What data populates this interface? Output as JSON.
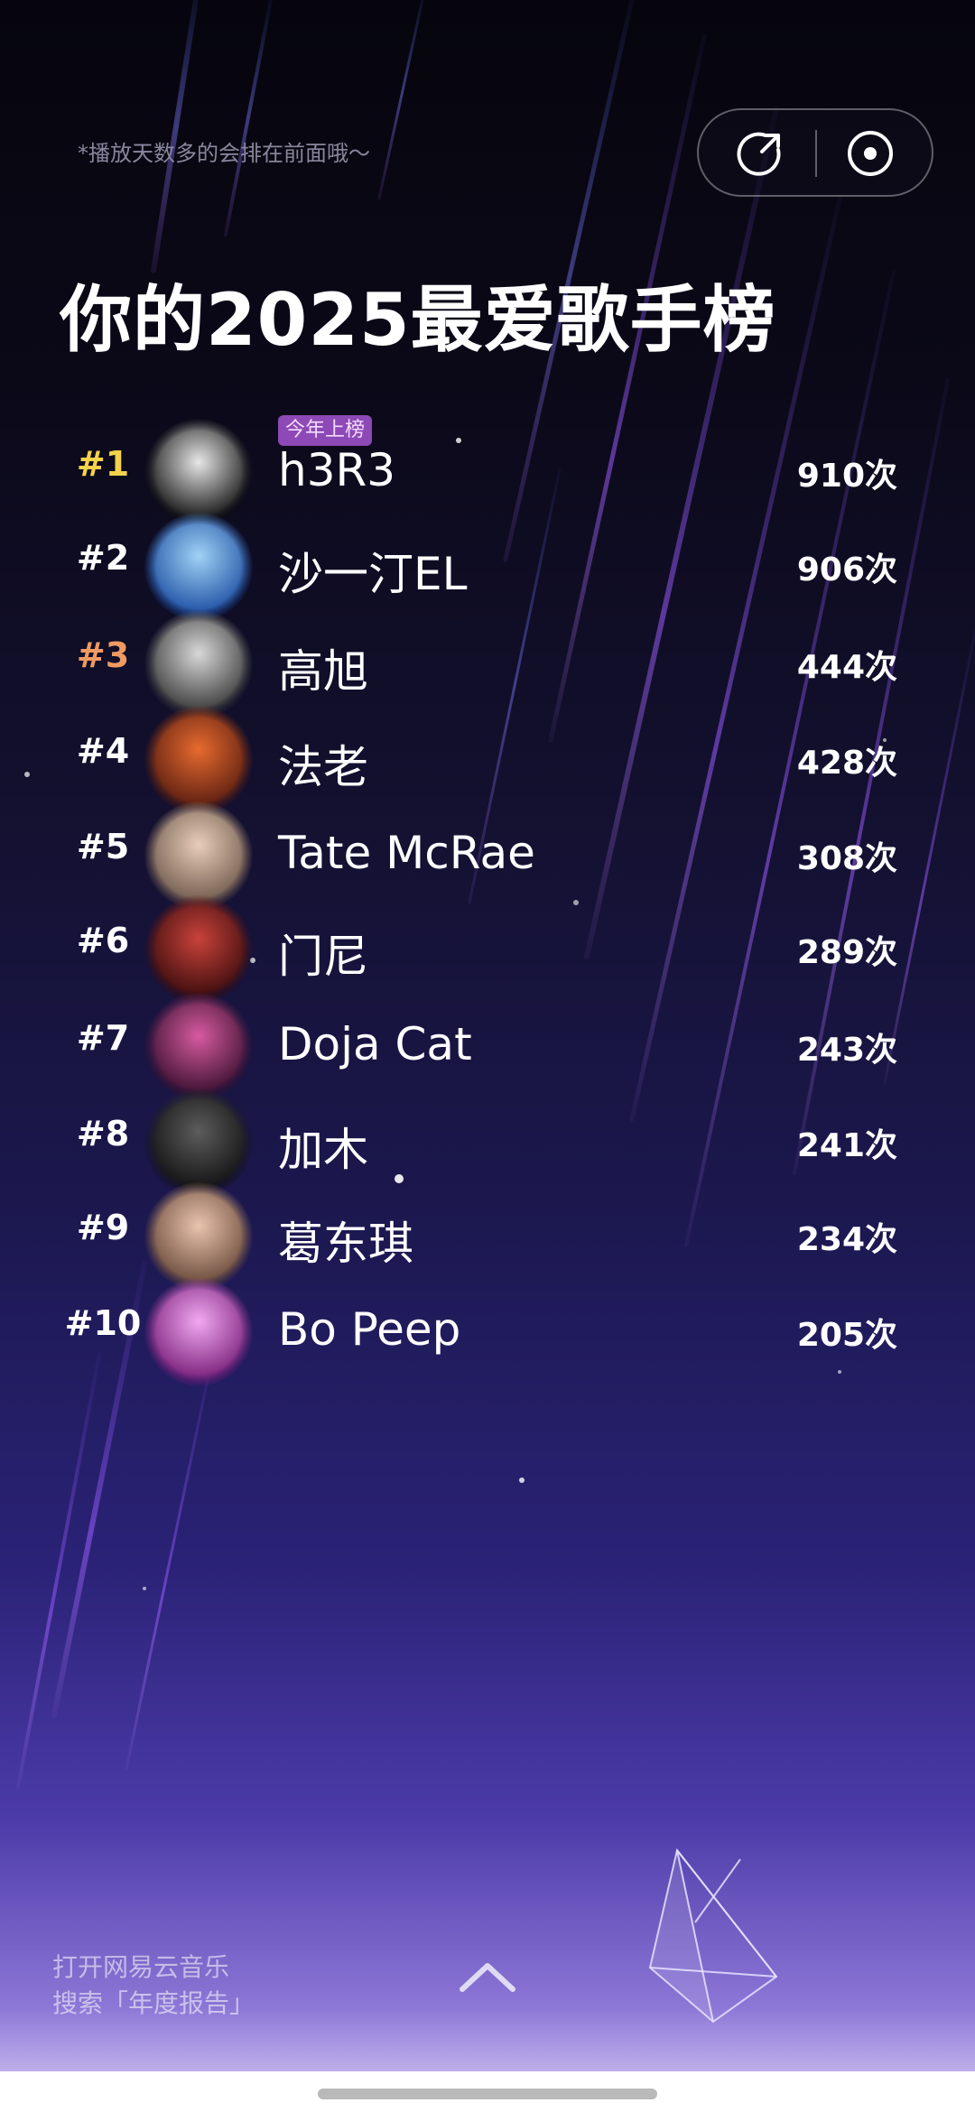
{
  "header": {
    "hint": "*播放天数多的会排在前面哦～",
    "title": "你的2025最爱歌手榜",
    "actions": {
      "share_icon": "share-icon",
      "record_icon": "vinyl-record-icon"
    }
  },
  "ranking": [
    {
      "rank": "#1",
      "name": "h3R3",
      "count": "910次",
      "badge": "今年上榜",
      "rank_color": "#f4d24a",
      "avatar_colors": [
        "#e7e7e7",
        "#111111"
      ]
    },
    {
      "rank": "#2",
      "name": "沙一汀EL",
      "count": "906次",
      "rank_color": "#ffffff",
      "avatar_colors": [
        "#9fd2f5",
        "#1e4fa3"
      ]
    },
    {
      "rank": "#3",
      "name": "高旭",
      "count": "444次",
      "rank_color": "#f09a63",
      "avatar_colors": [
        "#d8d8d8",
        "#3a3a3a"
      ]
    },
    {
      "rank": "#4",
      "name": "法老",
      "count": "428次",
      "rank_color": "#ffffff",
      "avatar_colors": [
        "#e76a2f",
        "#5a1e10"
      ]
    },
    {
      "rank": "#5",
      "name": "Tate McRae",
      "count": "308次",
      "rank_color": "#ffffff",
      "avatar_colors": [
        "#e8cdb9",
        "#6f5a4c"
      ]
    },
    {
      "rank": "#6",
      "name": "门尼",
      "count": "289次",
      "rank_color": "#ffffff",
      "avatar_colors": [
        "#c9423b",
        "#3d0d0d"
      ]
    },
    {
      "rank": "#7",
      "name": "Doja Cat",
      "count": "243次",
      "rank_color": "#ffffff",
      "avatar_colors": [
        "#d65b9f",
        "#3b1030"
      ]
    },
    {
      "rank": "#8",
      "name": "加木",
      "count": "241次",
      "rank_color": "#ffffff",
      "avatar_colors": [
        "#5c5c5c",
        "#111111"
      ]
    },
    {
      "rank": "#9",
      "name": "葛东琪",
      "count": "234次",
      "rank_color": "#ffffff",
      "avatar_colors": [
        "#e8c4ae",
        "#6b4a3a"
      ]
    },
    {
      "rank": "#10",
      "name": "Bo Peep",
      "count": "205次",
      "rank_color": "#ffffff",
      "avatar_colors": [
        "#f0a8f0",
        "#7a1f7a"
      ]
    }
  ],
  "footer": {
    "line1": "打开网易云音乐",
    "line2": "搜索「年度报告」",
    "scroll_icon": "chevron-up-icon"
  }
}
